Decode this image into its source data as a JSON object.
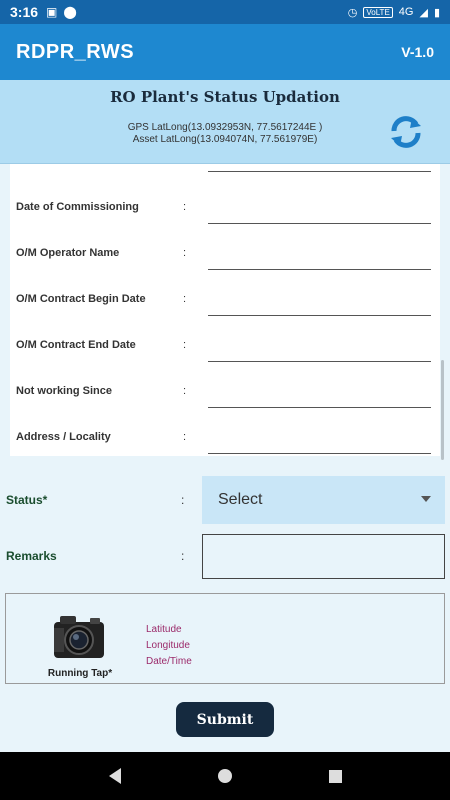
{
  "status_bar": {
    "time": "3:16",
    "network": "4G",
    "volte": "VoLTE"
  },
  "app_bar": {
    "title": "RDPR_RWS",
    "version": "V-1.0"
  },
  "subheader": {
    "title": "RO Plant's Status Updation",
    "gps_latlong": "GPS LatLong(13.0932953N, 77.5617244E )",
    "asset_latlong": "Asset LatLong(13.094074N, 77.561979E)"
  },
  "form": {
    "fields": [
      {
        "label": "Date of Commissioning",
        "colon": ":",
        "value": ""
      },
      {
        "label": "O/M Operator Name",
        "colon": ":",
        "value": ""
      },
      {
        "label": "O/M Contract Begin Date",
        "colon": ":",
        "value": ""
      },
      {
        "label": "O/M Contract End Date",
        "colon": ":",
        "value": ""
      },
      {
        "label": "Not working Since",
        "colon": ":",
        "value": ""
      },
      {
        "label": "Address / Locality",
        "colon": ":",
        "value": ""
      }
    ]
  },
  "status": {
    "label": "Status*",
    "colon": ":",
    "selected": "Select"
  },
  "remarks": {
    "label": "Remarks",
    "colon": ":",
    "value": ""
  },
  "photo": {
    "caption": "Running Tap*",
    "latitude_label": "Latitude",
    "longitude_label": "Longitude",
    "datetime_label": "Date/Time"
  },
  "submit_label": "Submit",
  "colors": {
    "appbar": "#1e88d0",
    "subheader": "#b3def5",
    "background": "#e8f4fa",
    "submit": "#152a3f",
    "geo_text": "#9b2a6a"
  }
}
